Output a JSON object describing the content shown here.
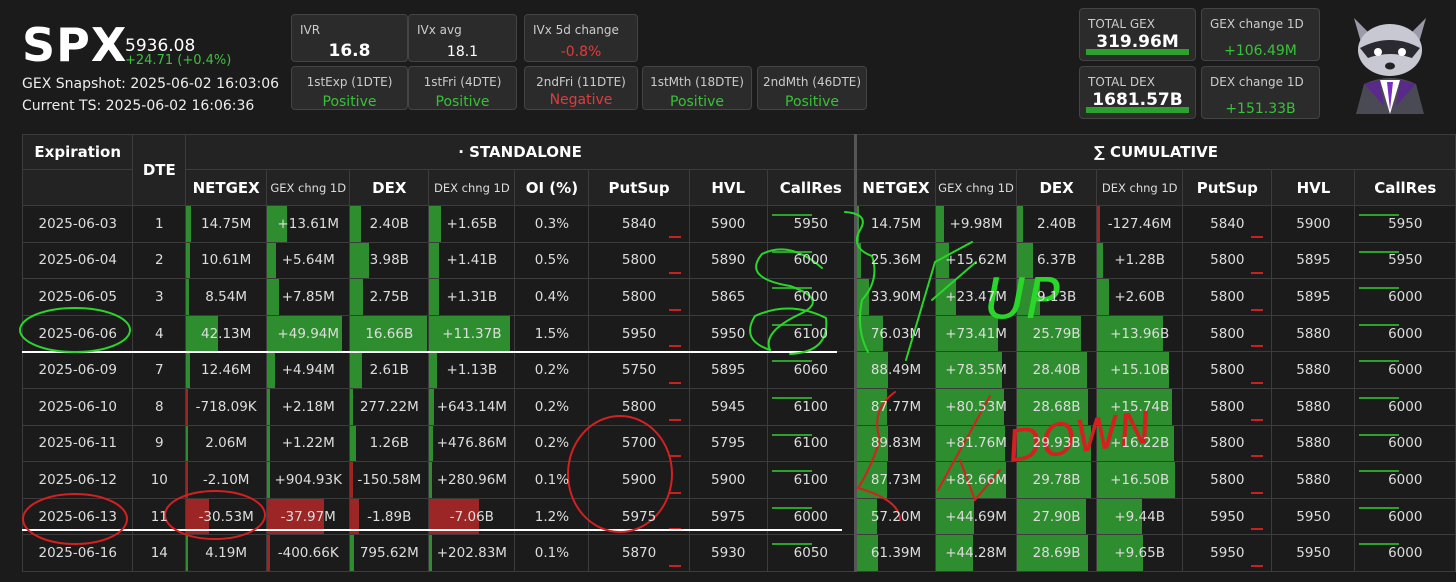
{
  "header": {
    "ticker": "SPX",
    "price": "5936.08",
    "change": "+24.71 (+0.4%)",
    "snapshot": "GEX Snapshot: 2025-06-02 16:03:06",
    "current_ts": "Current TS: 2025-06-02 16:06:36"
  },
  "metrics": {
    "ivr": {
      "label": "IVR",
      "value": "16.8"
    },
    "ivx_avg": {
      "label": "IVx avg",
      "value": "18.1"
    },
    "ivx_5d": {
      "label": "IVx 5d change",
      "value": "-0.8%"
    },
    "exp1": {
      "label": "1stExp (1DTE)",
      "value": "Positive"
    },
    "exp2": {
      "label": "1stFri (4DTE)",
      "value": "Positive"
    },
    "exp3": {
      "label": "2ndFri (11DTE)",
      "value": "Negative"
    },
    "exp4": {
      "label": "1stMth (18DTE)",
      "value": "Positive"
    },
    "exp5": {
      "label": "2ndMth (46DTE)",
      "value": "Positive"
    },
    "total_gex": {
      "label": "TOTAL GEX",
      "value": "319.96M"
    },
    "gex_change": {
      "label": "GEX change 1D",
      "value": "+106.49M"
    },
    "total_dex": {
      "label": "TOTAL DEX",
      "value": "1681.57B"
    },
    "dex_change": {
      "label": "DEX change 1D",
      "value": "+151.33B"
    }
  },
  "colors": {
    "positive": "#37c237",
    "negative": "#e03c3c",
    "bar_green": "#2e8d2e",
    "bar_red": "#9c2626"
  },
  "table": {
    "h_expiration": "Expiration",
    "h_dte": "DTE",
    "h_standalone": "· STANDALONE",
    "h_cumulative": "∑ CUMULATIVE",
    "cols": [
      "NETGEX",
      "GEX chng 1D",
      "DEX",
      "DEX chng 1D",
      "OI (%)",
      "PutSup",
      "HVL",
      "CallRes"
    ],
    "cum_cols": [
      "NETGEX",
      "GEX chng 1D",
      "DEX",
      "DEX chng 1D",
      "PutSup",
      "HVL",
      "CallRes"
    ],
    "rows": [
      {
        "exp": "2025-06-03",
        "dte": "1",
        "netgex": "14.75M",
        "gexchg": "+13.61M",
        "dex": "2.40B",
        "dexchg": "+1.65B",
        "oi": "0.3%",
        "putsup": "5840",
        "hvl": "5900",
        "callres": "5950",
        "c_netgex": "14.75M",
        "c_gexchg": "+9.98M",
        "c_dex": "2.40B",
        "c_dexchg": "-127.46M",
        "c_putsup": "5840",
        "c_hvl": "5900",
        "c_callres": "5950"
      },
      {
        "exp": "2025-06-04",
        "dte": "2",
        "netgex": "10.61M",
        "gexchg": "+5.64M",
        "dex": "3.98B",
        "dexchg": "+1.41B",
        "oi": "0.5%",
        "putsup": "5800",
        "hvl": "5890",
        "callres": "6000",
        "c_netgex": "25.36M",
        "c_gexchg": "+15.62M",
        "c_dex": "6.37B",
        "c_dexchg": "+1.28B",
        "c_putsup": "5800",
        "c_hvl": "5895",
        "c_callres": "5950"
      },
      {
        "exp": "2025-06-05",
        "dte": "3",
        "netgex": "8.54M",
        "gexchg": "+7.85M",
        "dex": "2.75B",
        "dexchg": "+1.31B",
        "oi": "0.4%",
        "putsup": "5800",
        "hvl": "5865",
        "callres": "6000",
        "c_netgex": "33.90M",
        "c_gexchg": "+23.47M",
        "c_dex": "9.13B",
        "c_dexchg": "+2.60B",
        "c_putsup": "5800",
        "c_hvl": "5895",
        "c_callres": "6000"
      },
      {
        "exp": "2025-06-06",
        "dte": "4",
        "netgex": "42.13M",
        "gexchg": "+49.94M",
        "dex": "16.66B",
        "dexchg": "+11.37B",
        "oi": "1.5%",
        "putsup": "5950",
        "hvl": "5950",
        "callres": "6100",
        "c_netgex": "76.03M",
        "c_gexchg": "+73.41M",
        "c_dex": "25.79B",
        "c_dexchg": "+13.96B",
        "c_putsup": "5800",
        "c_hvl": "5880",
        "c_callres": "6000"
      },
      {
        "exp": "2025-06-09",
        "dte": "7",
        "netgex": "12.46M",
        "gexchg": "+4.94M",
        "dex": "2.61B",
        "dexchg": "+1.13B",
        "oi": "0.2%",
        "putsup": "5750",
        "hvl": "5895",
        "callres": "6060",
        "c_netgex": "88.49M",
        "c_gexchg": "+78.35M",
        "c_dex": "28.40B",
        "c_dexchg": "+15.10B",
        "c_putsup": "5800",
        "c_hvl": "5880",
        "c_callres": "6000"
      },
      {
        "exp": "2025-06-10",
        "dte": "8",
        "netgex": "-718.09K",
        "gexchg": "+2.18M",
        "dex": "277.22M",
        "dexchg": "+643.14M",
        "oi": "0.2%",
        "putsup": "5800",
        "hvl": "5945",
        "callres": "6100",
        "c_netgex": "87.77M",
        "c_gexchg": "+80.53M",
        "c_dex": "28.68B",
        "c_dexchg": "+15.74B",
        "c_putsup": "5800",
        "c_hvl": "5880",
        "c_callres": "6000"
      },
      {
        "exp": "2025-06-11",
        "dte": "9",
        "netgex": "2.06M",
        "gexchg": "+1.22M",
        "dex": "1.26B",
        "dexchg": "+476.86M",
        "oi": "0.2%",
        "putsup": "5700",
        "hvl": "5795",
        "callres": "6100",
        "c_netgex": "89.83M",
        "c_gexchg": "+81.76M",
        "c_dex": "29.93B",
        "c_dexchg": "+16.22B",
        "c_putsup": "5800",
        "c_hvl": "5880",
        "c_callres": "6000"
      },
      {
        "exp": "2025-06-12",
        "dte": "10",
        "netgex": "-2.10M",
        "gexchg": "+904.93K",
        "dex": "-150.58M",
        "dexchg": "+280.96M",
        "oi": "0.1%",
        "putsup": "5900",
        "hvl": "5900",
        "callres": "6100",
        "c_netgex": "87.73M",
        "c_gexchg": "+82.66M",
        "c_dex": "29.78B",
        "c_dexchg": "+16.50B",
        "c_putsup": "5800",
        "c_hvl": "5880",
        "c_callres": "6000"
      },
      {
        "exp": "2025-06-13",
        "dte": "11",
        "netgex": "-30.53M",
        "gexchg": "-37.97M",
        "dex": "-1.89B",
        "dexchg": "-7.06B",
        "oi": "1.2%",
        "putsup": "5975",
        "hvl": "5975",
        "callres": "6000",
        "c_netgex": "57.20M",
        "c_gexchg": "+44.69M",
        "c_dex": "27.90B",
        "c_dexchg": "+9.44B",
        "c_putsup": "5950",
        "c_hvl": "5950",
        "c_callres": "6000"
      },
      {
        "exp": "2025-06-16",
        "dte": "14",
        "netgex": "4.19M",
        "gexchg": "-400.66K",
        "dex": "795.62M",
        "dexchg": "+202.83M",
        "oi": "0.1%",
        "putsup": "5870",
        "hvl": "5930",
        "callres": "6050",
        "c_netgex": "61.39M",
        "c_gexchg": "+44.28M",
        "c_dex": "28.69B",
        "c_dexchg": "+9.65B",
        "c_putsup": "5950",
        "c_hvl": "5950",
        "c_callres": "6000"
      }
    ]
  },
  "annotations": {
    "up": "UP",
    "down": "DOWN"
  }
}
